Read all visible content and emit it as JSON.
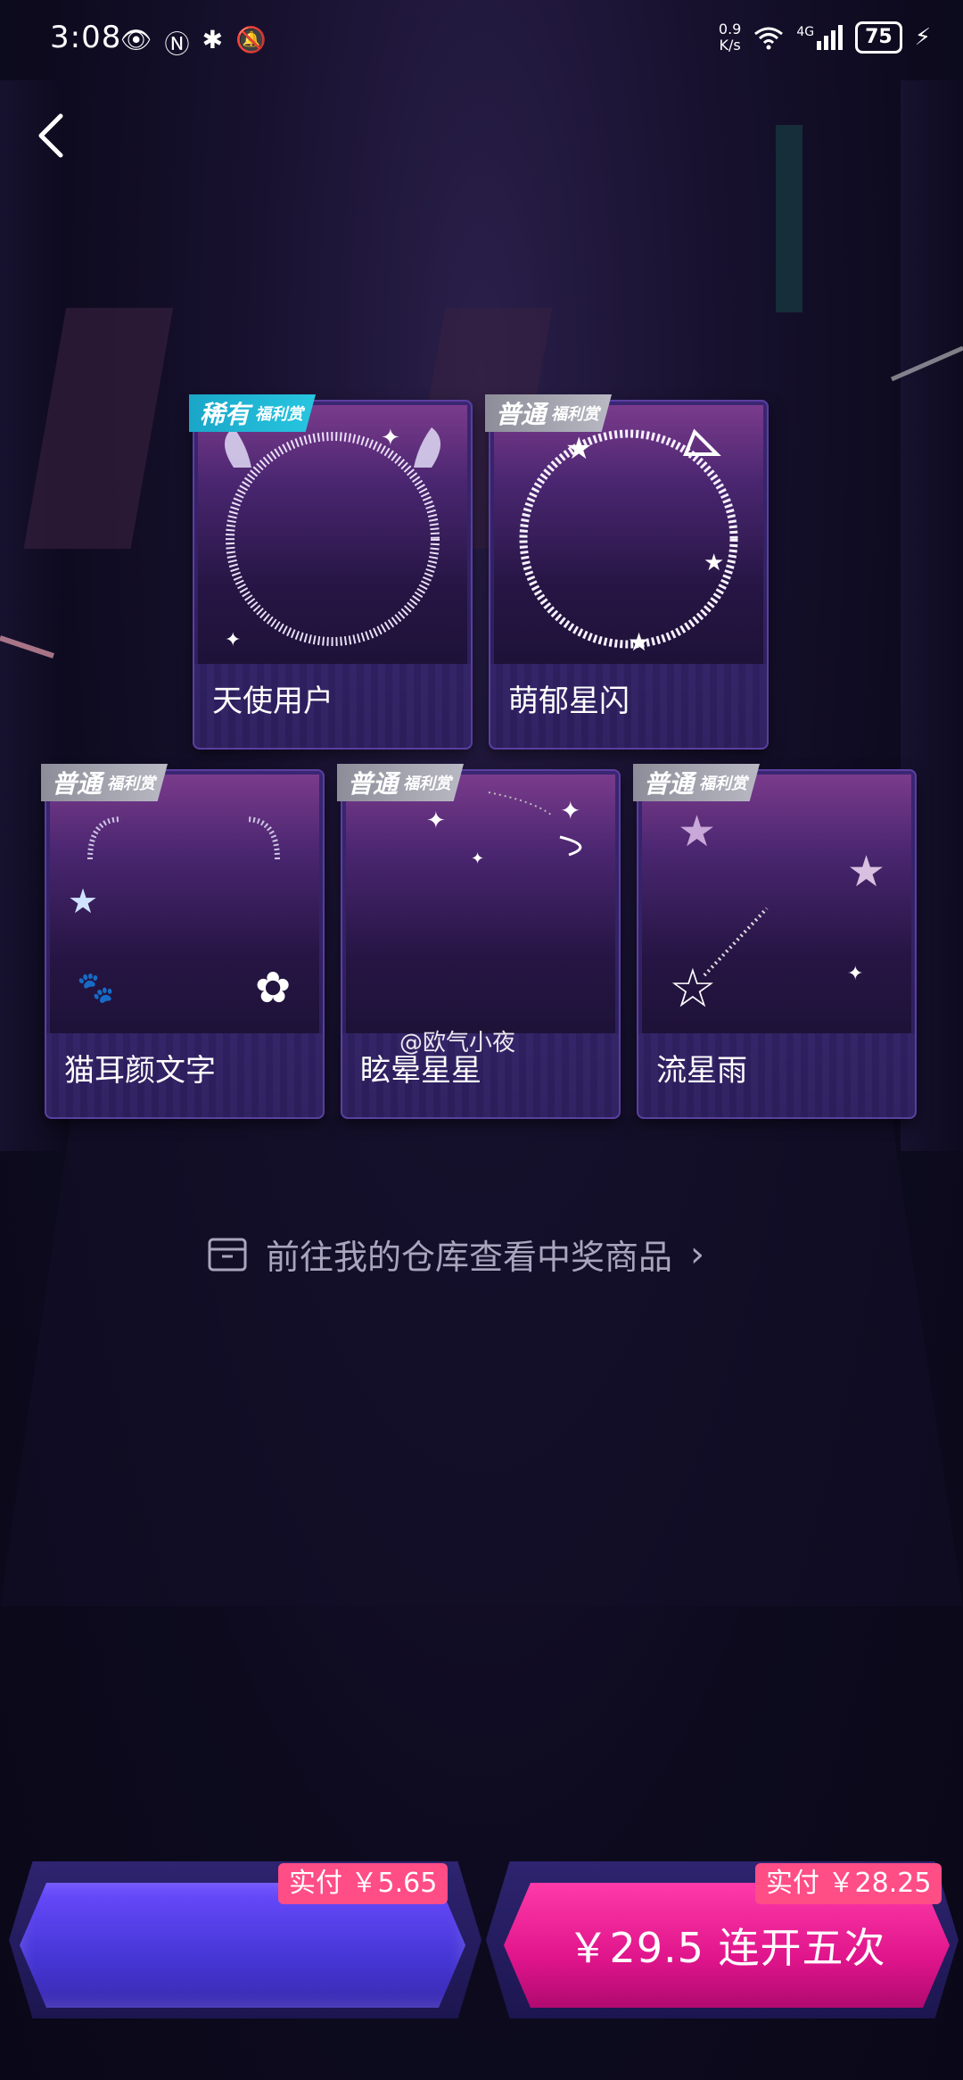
{
  "status_bar": {
    "time": "3:08",
    "net_speed_value": "0.9",
    "net_speed_unit": "K/s",
    "network": "4G",
    "battery": "75"
  },
  "cards": [
    {
      "badge": "稀有",
      "badge_sub": "福利赏",
      "label": "天使用户",
      "rarity": "rare"
    },
    {
      "badge": "普通",
      "badge_sub": "福利赏",
      "label": "萌郁星闪",
      "rarity": "common"
    },
    {
      "badge": "普通",
      "badge_sub": "福利赏",
      "label": "猫耳颜文字",
      "rarity": "common"
    },
    {
      "badge": "普通",
      "badge_sub": "福利赏",
      "label": "眩晕星星",
      "rarity": "common"
    },
    {
      "badge": "普通",
      "badge_sub": "福利赏",
      "label": "流星雨",
      "rarity": "common"
    }
  ],
  "warehouse_link": "前往我的仓库查看中奖商品",
  "watermark": "@欧气小夜",
  "actions": {
    "left_price_tag": "实付 ￥5.65",
    "left_button_label": "",
    "right_price_tag": "实付 ￥28.25",
    "right_button_label": "￥29.5 连开五次"
  },
  "colors": {
    "rare_badge": "#1aa6c8",
    "common_badge": "#8d8d99",
    "left_button": "#5a44f0",
    "right_button": "#e0158c",
    "price_tag": "#ff4d86"
  }
}
